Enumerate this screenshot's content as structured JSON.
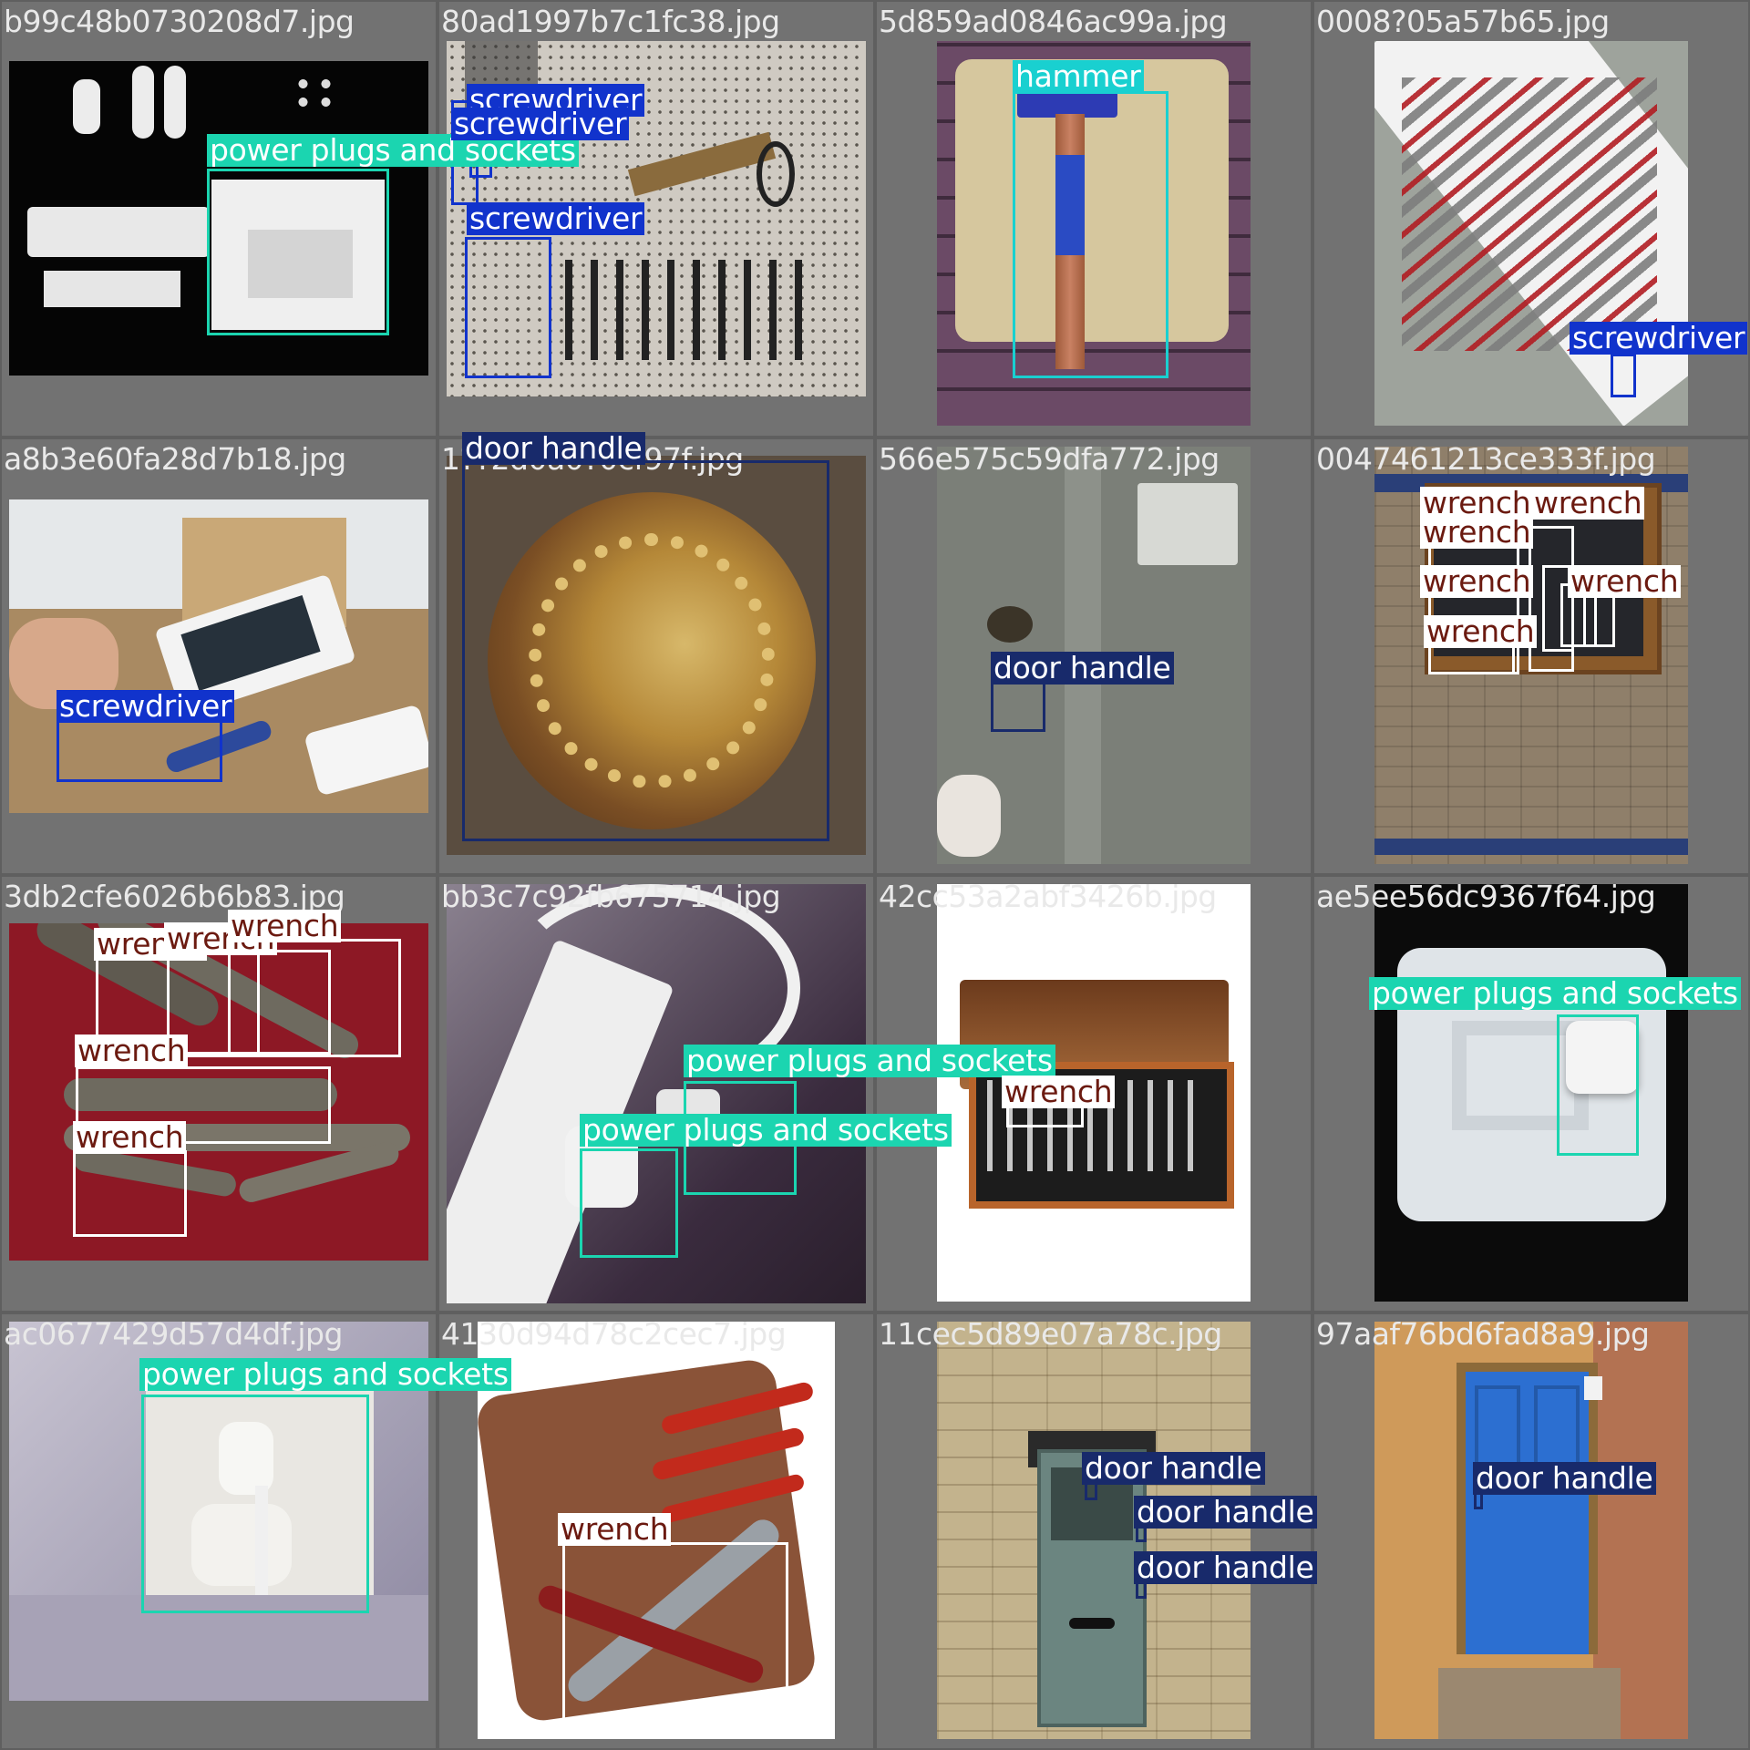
{
  "colors": {
    "power plugs and sockets": "#1bd5b0",
    "screwdriver": "#1133cc",
    "hammer": "#19d0d0",
    "door handle": "#182a6b",
    "wrench": "#ffffff"
  },
  "tiles": [
    {
      "filename": "b99c48b0730208d7.jpg",
      "labels": [
        "power plugs and sockets"
      ]
    },
    {
      "filename": "80ad1997b7c1fc38.jpg",
      "labels": [
        "screwdriver",
        "screwdriver",
        "screwdriver"
      ]
    },
    {
      "filename": "5d859ad0846ac99a.jpg",
      "labels": [
        "hammer"
      ]
    },
    {
      "filename": "0008?05a57b65.jpg",
      "labels": [
        "screwdriver"
      ]
    },
    {
      "filename": "a8b3e60fa28d7b18.jpg",
      "labels": [
        "screwdriver"
      ]
    },
    {
      "filename": "1??2d0a0?0cf97f.jpg",
      "labels": [
        "door handle"
      ]
    },
    {
      "filename": "566e575c59dfa772.jpg",
      "labels": [
        "door handle"
      ]
    },
    {
      "filename": "0047461213ce333f.jpg",
      "labels": [
        "wrench",
        "wrench",
        "wrench",
        "wrench",
        "wrench",
        "wrench"
      ]
    },
    {
      "filename": "3db2cfe6026b6b83.jpg",
      "labels": [
        "wrench",
        "wrench",
        "wrench",
        "wrench",
        "wrench"
      ]
    },
    {
      "filename": "bb3c7c92fb675714.jpg",
      "labels": [
        "power plugs and sockets",
        "power plugs and sockets"
      ]
    },
    {
      "filename": "42cc53a2abf3426b.jpg",
      "labels": [
        "wrench"
      ]
    },
    {
      "filename": "ae5ee56dc9367f64.jpg",
      "labels": [
        "power plugs and sockets"
      ]
    },
    {
      "filename": "ac0677429d57d4df.jpg",
      "labels": [
        "power plugs and sockets"
      ]
    },
    {
      "filename": "4130d94d78c2cec7.jpg",
      "labels": [
        "wrench"
      ]
    },
    {
      "filename": "11cec5d89e07a78c.jpg",
      "labels": [
        "door handle",
        "door handle",
        "door handle"
      ]
    },
    {
      "filename": "97aaf76bd6fad8a9.jpg",
      "labels": [
        "door handle"
      ]
    }
  ]
}
